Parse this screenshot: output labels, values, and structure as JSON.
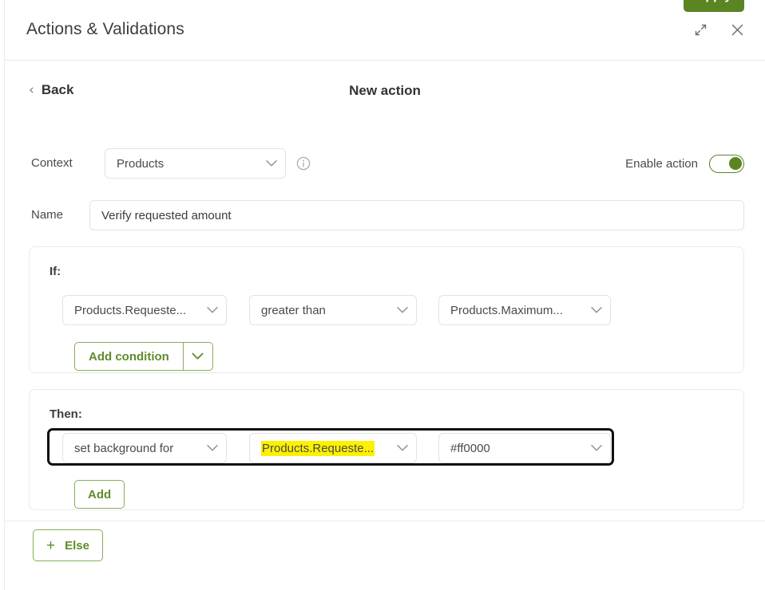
{
  "window": {
    "title": "Actions & Validations",
    "expand_icon": "expand-icon",
    "close_icon": "close-icon"
  },
  "header": {
    "back_label": "Back",
    "back_chevron": "‹",
    "title": "New action",
    "apply_label": "Apply"
  },
  "context_row": {
    "label": "Context",
    "selected": "Products",
    "info_icon": "info-icon",
    "toggle_label": "Enable action",
    "toggle_state": "on"
  },
  "name_row": {
    "label": "Name",
    "value": "Verify requested amount",
    "placeholder": "Name"
  },
  "if_block": {
    "title": "If:",
    "condition": {
      "field": "Products.Requeste...",
      "operator": "greater than",
      "value": "Products.Maximum..."
    },
    "add_condition_label": "Add condition"
  },
  "then_block": {
    "title": "Then:",
    "action": {
      "operation": "set background for",
      "target": "Products.Requeste...",
      "value": "#ff0000"
    },
    "add_label": "Add"
  },
  "footer": {
    "else_label": "Else",
    "else_plus": "+"
  },
  "colors": {
    "accent_green": "#5a8522",
    "button_border_green": "#86ae55",
    "highlight_yellow": "#fdf000",
    "focus_ring": "#0f0f0f",
    "action_color_value": "#ff0000"
  }
}
